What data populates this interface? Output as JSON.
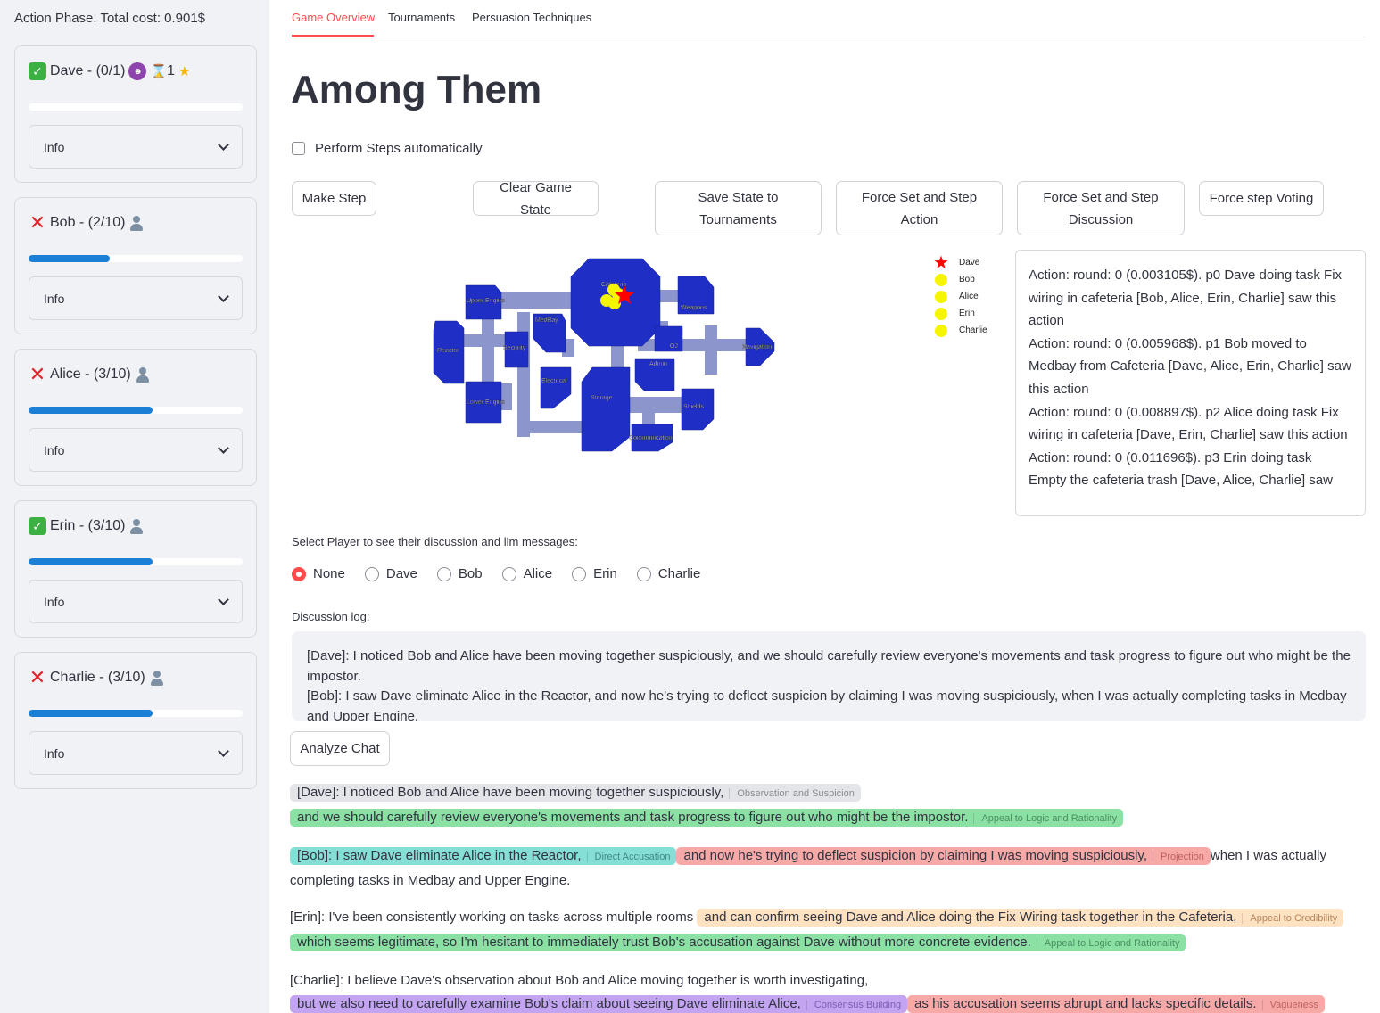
{
  "sidebar": {
    "phase": "Action Phase. Total cost: 0.901$",
    "players": [
      {
        "name": "Dave - (0/1)",
        "ok": true,
        "progress": 0.0,
        "extra": "1",
        "info": "Info"
      },
      {
        "name": "Bob - (2/10)",
        "ok": false,
        "progress": 0.38,
        "info": "Info"
      },
      {
        "name": "Alice - (3/10)",
        "ok": false,
        "progress": 0.58,
        "info": "Info"
      },
      {
        "name": "Erin - (3/10)",
        "ok": true,
        "progress": 0.58,
        "info": "Info"
      },
      {
        "name": "Charlie - (3/10)",
        "ok": false,
        "progress": 0.58,
        "info": "Info"
      }
    ]
  },
  "tabs": [
    "Game Overview",
    "Tournaments",
    "Persuasion Techniques"
  ],
  "title": "Among Them",
  "auto_label": "Perform Steps automatically",
  "buttons": {
    "make_step": "Make Step",
    "clear": "Clear Game State",
    "save_line1": "Save State to",
    "save_line2": "Tournaments",
    "force_action_line1": "Force Set and Step",
    "force_action_line2": "Action",
    "force_disc_line1": "Force Set and Step",
    "force_disc_line2": "Discussion",
    "force_voting": "Force step Voting",
    "analyze": "Analyze Chat"
  },
  "map": {
    "rooms": [
      "Cafeteria",
      "Upper Engine",
      "MedBay",
      "Weapons",
      "Reactor",
      "Security",
      "O2",
      "Navigation",
      "Admin",
      "Electrical",
      "Lower Engine",
      "Storage",
      "Shields",
      "Communication"
    ]
  },
  "legend": [
    "Dave",
    "Bob",
    "Alice",
    "Erin",
    "Charlie"
  ],
  "action_log": [
    "Action: round: 0 (0.003105$). p0 Dave doing task Fix wiring in cafeteria [Bob, Alice, Erin, Charlie] saw this action",
    "Action: round: 0 (0.005968$). p1 Bob moved to Medbay from Cafeteria [Dave, Alice, Erin, Charlie] saw this action",
    "Action: round: 0 (0.008897$). p2 Alice doing task Fix wiring in cafeteria [Dave, Erin, Charlie] saw this action",
    "Action: round: 0 (0.011696$). p3 Erin doing task Empty the cafeteria trash [Dave, Alice, Charlie] saw"
  ],
  "select_label": "Select Player to see their discussion and llm messages:",
  "radio_options": [
    "None",
    "Dave",
    "Bob",
    "Alice",
    "Erin",
    "Charlie"
  ],
  "radio_selected": "None",
  "discussion_label": "Discussion log:",
  "discussion_log": [
    "[Dave]: I noticed Bob and Alice have been moving together suspiciously, and we should carefully review everyone's movements and task progress to figure out who might be the impostor.",
    "[Bob]: I saw Dave eliminate Alice in the Reactor, and now he's trying to deflect suspicion by claiming I was moving suspiciously, when I was actually completing tasks in Medbay and Upper Engine."
  ],
  "analysis": {
    "dave1": "[Dave]: I noticed Bob and Alice have been moving together suspiciously,",
    "dave1_tag": "Observation and Suspicion",
    "dave2": "and we should carefully review everyone's movements and task progress to figure out who might be the impostor.",
    "dave2_tag": "Appeal to Logic and Rationality",
    "bob1": "[Bob]: I saw Dave eliminate Alice in the Reactor,",
    "bob1_tag": "Direct Accusation",
    "bob2": "and now he's trying to deflect suspicion by claiming I was moving suspiciously,",
    "bob2_tag": "Projection",
    "bob3": "when I was actually completing tasks in Medbay and Upper Engine.",
    "erin1": "[Erin]: I've been consistently working on tasks across multiple rooms",
    "erin2": "and can confirm seeing Dave and Alice doing the Fix Wiring task together in the Cafeteria,",
    "erin2_tag": "Appeal to Credibility",
    "erin3": "which seems legitimate, so I'm hesitant to immediately trust Bob's accusation against Dave without more concrete evidence.",
    "erin3_tag": "Appeal to Logic and Rationality",
    "charlie1": "[Charlie]: I believe Dave's observation about Bob and Alice moving together is worth investigating,",
    "charlie2": "but we also need to carefully examine Bob's claim about seeing Dave eliminate Alice,",
    "charlie2_tag": "Consensus Building",
    "charlie3": "as his accusation seems abrupt and lacks specific details.",
    "charlie3_tag": "Vagueness"
  }
}
